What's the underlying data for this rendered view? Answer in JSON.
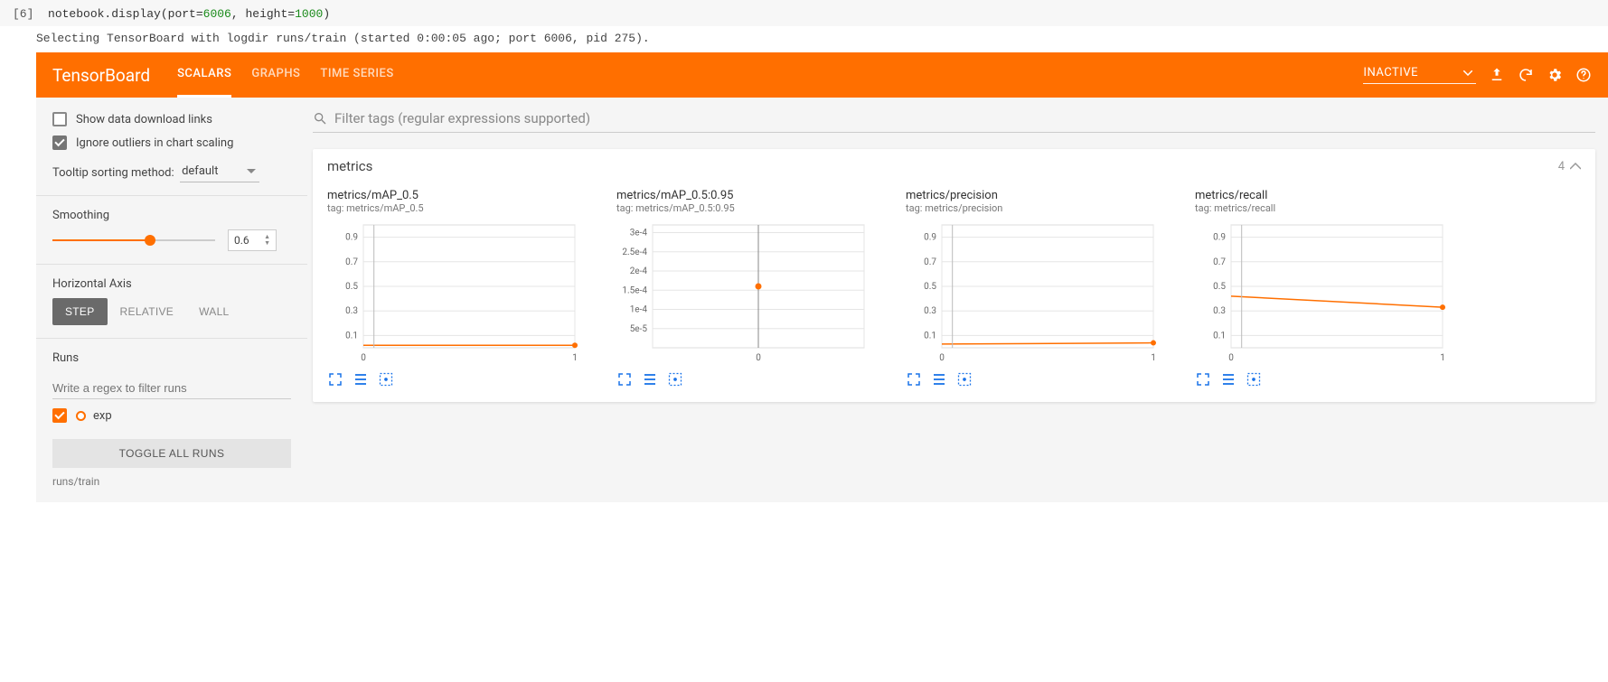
{
  "notebook": {
    "cell_index": "[6]",
    "code_prefix": "notebook.display(port=",
    "code_port": "6006",
    "code_mid": ", height=",
    "code_height": "1000",
    "code_suffix": ")",
    "output": "Selecting TensorBoard with logdir runs/train (started 0:00:05 ago; port 6006, pid 275)."
  },
  "header": {
    "title": "TensorBoard",
    "tabs": [
      "SCALARS",
      "GRAPHS",
      "TIME SERIES"
    ],
    "active_tab": 0,
    "status": "INACTIVE"
  },
  "sidebar": {
    "show_download": {
      "label": "Show data download links",
      "checked": false
    },
    "ignore_outliers": {
      "label": "Ignore outliers in chart scaling",
      "checked": true
    },
    "tooltip_label": "Tooltip sorting method:",
    "tooltip_value": "default",
    "smoothing_label": "Smoothing",
    "smoothing_value": "0.6",
    "haxis_label": "Horizontal Axis",
    "haxis_options": [
      "STEP",
      "RELATIVE",
      "WALL"
    ],
    "haxis_active": 0,
    "runs_label": "Runs",
    "runs_filter_placeholder": "Write a regex to filter runs",
    "run_name": "exp",
    "toggle_all": "TOGGLE ALL RUNS",
    "logdir": "runs/train"
  },
  "main": {
    "filter_placeholder": "Filter tags (regular expressions supported)",
    "section_title": "metrics",
    "section_count": "4"
  },
  "chart_data": [
    {
      "title": "metrics/mAP_0.5",
      "tag": "tag: metrics/mAP_0.5",
      "type": "line",
      "x": [
        0,
        1
      ],
      "values": [
        0.02,
        0.02
      ],
      "y_ticks": [
        0.1,
        0.3,
        0.5,
        0.7,
        0.9
      ],
      "x_ticks": [
        0,
        1
      ],
      "ylim": [
        0,
        1
      ],
      "xlim": [
        0,
        1
      ]
    },
    {
      "title": "metrics/mAP_0.5:0.95",
      "tag": "tag: metrics/mAP_0.5:0.95",
      "type": "line",
      "x": [
        0,
        1
      ],
      "values": [
        0.00016,
        0.00016
      ],
      "y_ticks_labels": [
        "5e-5",
        "1e-4",
        "1.5e-4",
        "2e-4",
        "2.5e-4",
        "3e-4"
      ],
      "y_ticks": [
        5e-05,
        0.0001,
        0.00015,
        0.0002,
        0.00025,
        0.0003
      ],
      "x_ticks": [
        0
      ],
      "ylim": [
        0,
        0.00032
      ],
      "xlim": [
        -1,
        1
      ],
      "single_point_at": 0
    },
    {
      "title": "metrics/precision",
      "tag": "tag: metrics/precision",
      "type": "line",
      "x": [
        0,
        1
      ],
      "values": [
        0.03,
        0.04
      ],
      "y_ticks": [
        0.1,
        0.3,
        0.5,
        0.7,
        0.9
      ],
      "x_ticks": [
        0,
        1
      ],
      "ylim": [
        0,
        1
      ],
      "xlim": [
        0,
        1
      ]
    },
    {
      "title": "metrics/recall",
      "tag": "tag: metrics/recall",
      "type": "line",
      "x": [
        0,
        1
      ],
      "values": [
        0.42,
        0.33
      ],
      "y_ticks": [
        0.1,
        0.3,
        0.5,
        0.7,
        0.9
      ],
      "x_ticks": [
        0,
        1
      ],
      "ylim": [
        0,
        1
      ],
      "xlim": [
        0,
        1
      ]
    }
  ]
}
